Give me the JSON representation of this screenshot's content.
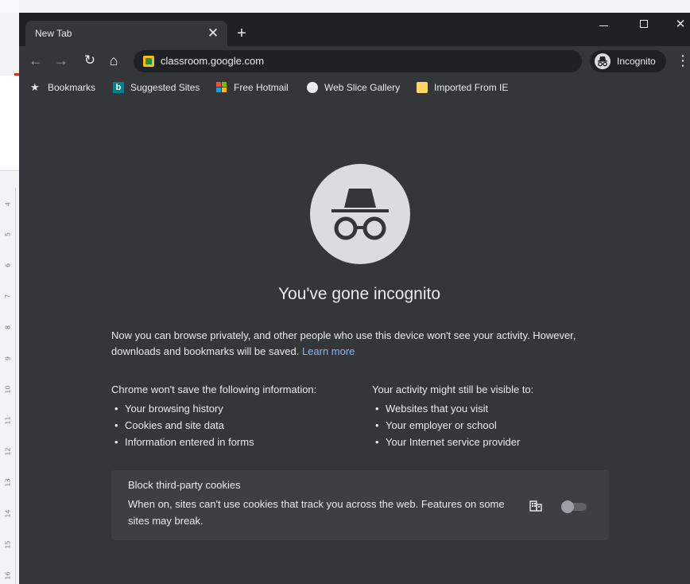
{
  "background": {
    "ruler_ticks": [
      "4",
      "5",
      "6",
      "7",
      "8",
      "9",
      "10",
      "11",
      "12",
      "13",
      "14",
      "15",
      "16"
    ]
  },
  "tab": {
    "title": "New Tab",
    "close_glyph": "✕",
    "new_tab_glyph": "+"
  },
  "window_controls": {
    "close_glyph": "✕"
  },
  "toolbar": {
    "back_glyph": "←",
    "forward_glyph": "→",
    "reload_glyph": "↻",
    "home_glyph": "⌂",
    "url": "classroom.google.com",
    "incognito_label": "Incognito",
    "menu_glyph": "⋮"
  },
  "bookmarks": [
    {
      "label": "Bookmarks",
      "icon": "star-icon"
    },
    {
      "label": "Suggested Sites",
      "icon": "bing-icon",
      "glyph": "b"
    },
    {
      "label": "Free Hotmail",
      "icon": "microsoft-icon"
    },
    {
      "label": "Web Slice Gallery",
      "icon": "globe-icon"
    },
    {
      "label": "Imported From IE",
      "icon": "folder-icon"
    }
  ],
  "page": {
    "headline": "You've gone incognito",
    "intro": "Now you can browse privately, and other people who use this device won't see your activity. However, downloads and bookmarks will be saved.",
    "learn_more": "Learn more",
    "not_saved_title": "Chrome won't save the following information:",
    "not_saved_items": [
      "Your browsing history",
      "Cookies and site data",
      "Information entered in forms"
    ],
    "visible_title": "Your activity might still be visible to:",
    "visible_items": [
      "Websites that you visit",
      "Your employer or school",
      "Your Internet service provider"
    ],
    "cookies_title": "Block third-party cookies",
    "cookies_desc": "When on, sites can't use cookies that track you across the web. Features on some sites may break.",
    "cookies_toggle_on": false
  },
  "colors": {
    "window_bg": "#35363a",
    "titlebar_bg": "#202124",
    "card_bg": "#3c4043",
    "text": "#e8eaed",
    "link": "#8ab4f8"
  }
}
